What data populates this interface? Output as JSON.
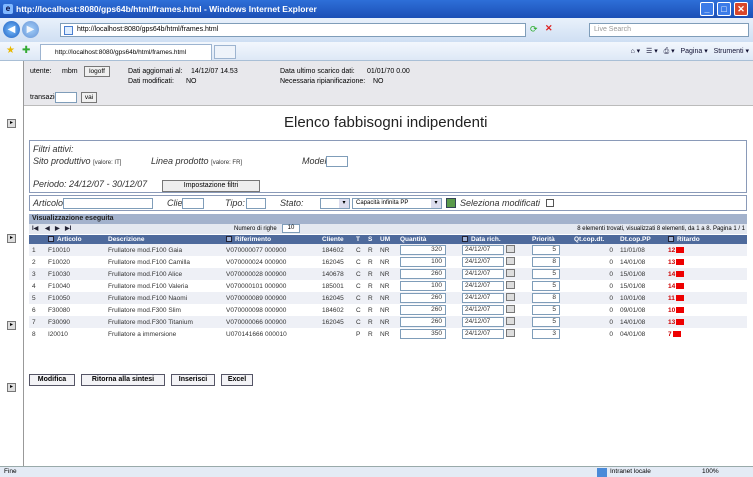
{
  "window": {
    "title": "http://localhost:8080/gps64b/html/frames.html - Windows Internet Explorer"
  },
  "browser": {
    "url": "http://localhost:8080/gps64b/html/frames.html",
    "search_placeholder": "Live Search",
    "tab_title": "http://localhost:8080/gps64b/html/frames.html",
    "tools": {
      "page": "Pagina",
      "tools": "Strumenti"
    }
  },
  "info": {
    "user_label": "utente:",
    "user": "mbm",
    "logoff": "logoff",
    "updated_label": "Dati aggiornati al:",
    "updated": "14/12/07 14.53",
    "modified_label": "Dati modificati:",
    "modified": "NO",
    "download_label": "Data ultimo scarico dati:",
    "download": "01/01/70 0.00",
    "replan_label": "Necessaria ripianificazione:",
    "replan": "NO",
    "transaction_label": "transazione:",
    "go": "vai"
  },
  "main": {
    "title": "Elenco fabbisogni indipendenti",
    "filters": {
      "heading": "Filtri attivi:",
      "site_label": "Sito produttivo",
      "site_value": "[valore: IT]",
      "line_label": "Linea prodotto",
      "line_value": "[valore: FR]",
      "model_label": "Modello",
      "period": "Periodo: 24/12/07 - 30/12/07",
      "button": "Impostazione filtri"
    },
    "search": {
      "article": "Articolo:",
      "client": "Cliente:",
      "type": "Tipo:",
      "state": "Stato:",
      "capacity": "Capacità infinita PP",
      "select_modified": "Seleziona modificati"
    },
    "result_bar": "Visualizzazione eseguita",
    "rows_label": "Numero di righe",
    "rows_value": "10",
    "page_info": "8 elementi trovati, visualizzati 8 elementi, da 1 a 8. Pagina 1 / 1",
    "columns": [
      "Articolo",
      "Descrizione",
      "Riferimento",
      "Cliente",
      "T",
      "S",
      "UM",
      "Quantità",
      "Data rich.",
      "Priorità",
      "Qt.cop.dt.",
      "Dt.cop.PP",
      "Ritardo"
    ],
    "rows": [
      {
        "n": "1",
        "art": "F10010",
        "desc": "Frullatore mod.F100 Gaia",
        "ref": "V070000077 000900",
        "cli": "184602",
        "t": "C",
        "s": "R",
        "um": "NR",
        "qty": "320",
        "date": "24/12/07",
        "prio": "5",
        "qtc": "0",
        "dtc": "11/01/08",
        "rit": "12"
      },
      {
        "n": "2",
        "art": "F10020",
        "desc": "Frullatore mod.F100 Camilla",
        "ref": "V070000024 000900",
        "cli": "162045",
        "t": "C",
        "s": "R",
        "um": "NR",
        "qty": "100",
        "date": "24/12/07",
        "prio": "8",
        "qtc": "0",
        "dtc": "14/01/08",
        "rit": "13"
      },
      {
        "n": "3",
        "art": "F10030",
        "desc": "Frullatore mod.F100 Alice",
        "ref": "V070000028 000900",
        "cli": "140678",
        "t": "C",
        "s": "R",
        "um": "NR",
        "qty": "260",
        "date": "24/12/07",
        "prio": "5",
        "qtc": "0",
        "dtc": "15/01/08",
        "rit": "14"
      },
      {
        "n": "4",
        "art": "F10040",
        "desc": "Frullatore mod.F100 Valeria",
        "ref": "V070000101 000900",
        "cli": "185001",
        "t": "C",
        "s": "R",
        "um": "NR",
        "qty": "100",
        "date": "24/12/07",
        "prio": "5",
        "qtc": "0",
        "dtc": "15/01/08",
        "rit": "14"
      },
      {
        "n": "5",
        "art": "F10050",
        "desc": "Frullatore mod.F100 Naomi",
        "ref": "V070000089 000900",
        "cli": "162045",
        "t": "C",
        "s": "R",
        "um": "NR",
        "qty": "260",
        "date": "24/12/07",
        "prio": "8",
        "qtc": "0",
        "dtc": "10/01/08",
        "rit": "11"
      },
      {
        "n": "6",
        "art": "F30080",
        "desc": "Frullatore mod.F300 Slim",
        "ref": "V070000098 000900",
        "cli": "184602",
        "t": "C",
        "s": "R",
        "um": "NR",
        "qty": "260",
        "date": "24/12/07",
        "prio": "5",
        "qtc": "0",
        "dtc": "09/01/08",
        "rit": "10"
      },
      {
        "n": "7",
        "art": "F30090",
        "desc": "Frullatore mod.F300 Titanium",
        "ref": "V070000066 000900",
        "cli": "162045",
        "t": "C",
        "s": "R",
        "um": "NR",
        "qty": "260",
        "date": "24/12/07",
        "prio": "5",
        "qtc": "0",
        "dtc": "14/01/08",
        "rit": "13"
      },
      {
        "n": "8",
        "art": "I20010",
        "desc": "Frullatore a immersione",
        "ref": "U070141666 000010",
        "cli": "",
        "t": "P",
        "s": "R",
        "um": "NR",
        "qty": "350",
        "date": "24/12/07",
        "prio": "3",
        "qtc": "0",
        "dtc": "04/01/08",
        "rit": "7"
      }
    ],
    "buttons": {
      "modify": "Modifica",
      "back": "Ritorna alla sintesi",
      "insert": "Inserisci",
      "excel": "Excel"
    }
  },
  "status": {
    "left": "Fine",
    "zone": "Intranet locale",
    "zoom": "100%"
  }
}
